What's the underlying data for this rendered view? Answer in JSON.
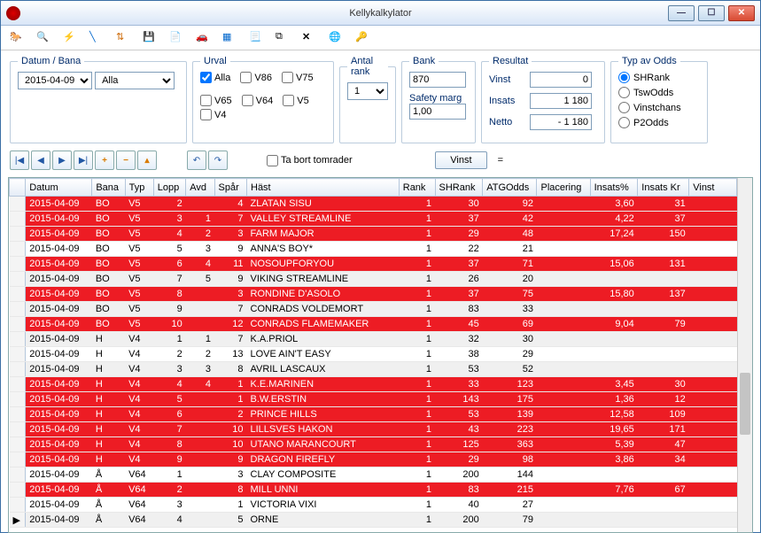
{
  "window": {
    "title": "Kellykalkylator"
  },
  "fieldsets": {
    "datum_bana": {
      "legend": "Datum / Bana",
      "date": "2015-04-09",
      "bana": "Alla"
    },
    "urval": {
      "legend": "Urval",
      "alla": "Alla",
      "v86": "V86",
      "v75": "V75",
      "v65": "V65",
      "v64": "V64",
      "v5": "V5",
      "v4": "V4"
    },
    "antal_rank": {
      "legend": "Antal rank",
      "value": "1"
    },
    "bank": {
      "legend": "Bank",
      "value": "870",
      "safety_label": "Safety marg",
      "safety_value": "1,00"
    },
    "resultat": {
      "legend": "Resultat",
      "vinst_label": "Vinst",
      "vinst": "0",
      "insats_label": "Insats",
      "insats": "1 180",
      "netto_label": "Netto",
      "netto": "- 1 180"
    },
    "typ": {
      "legend": "Typ av Odds",
      "shrank": "SHRank",
      "tswodds": "TswOdds",
      "vinstchans": "Vinstchans",
      "p2odds": "P2Odds"
    }
  },
  "tabort": "Ta bort tomrader",
  "vinst_btn": "Vinst",
  "eq": "=",
  "columns": [
    "",
    "Datum",
    "Bana",
    "Typ",
    "Lopp",
    "Avd",
    "Spår",
    "Häst",
    "Rank",
    "SHRank",
    "ATGOdds",
    "Placering",
    "Insats%",
    "Insats Kr",
    "Vinst"
  ],
  "rows": [
    {
      "red": true,
      "datum": "2015-04-09",
      "bana": "BO",
      "typ": "V5",
      "lopp": "2",
      "avd": "",
      "spar": "4",
      "hast": "ZLATAN SISU",
      "rank": "1",
      "shrank": "30",
      "atg": "92",
      "plac": "",
      "insp": "3,60",
      "inskr": "31",
      "vinst": ""
    },
    {
      "red": true,
      "datum": "2015-04-09",
      "bana": "BO",
      "typ": "V5",
      "lopp": "3",
      "avd": "1",
      "spar": "7",
      "hast": "VALLEY STREAMLINE",
      "rank": "1",
      "shrank": "37",
      "atg": "42",
      "plac": "",
      "insp": "4,22",
      "inskr": "37",
      "vinst": ""
    },
    {
      "red": true,
      "datum": "2015-04-09",
      "bana": "BO",
      "typ": "V5",
      "lopp": "4",
      "avd": "2",
      "spar": "3",
      "hast": "FARM MAJOR",
      "rank": "1",
      "shrank": "29",
      "atg": "48",
      "plac": "",
      "insp": "17,24",
      "inskr": "150",
      "vinst": ""
    },
    {
      "red": false,
      "datum": "2015-04-09",
      "bana": "BO",
      "typ": "V5",
      "lopp": "5",
      "avd": "3",
      "spar": "9",
      "hast": "ANNA'S BOY*",
      "rank": "1",
      "shrank": "22",
      "atg": "21",
      "plac": "",
      "insp": "",
      "inskr": "",
      "vinst": ""
    },
    {
      "red": true,
      "datum": "2015-04-09",
      "bana": "BO",
      "typ": "V5",
      "lopp": "6",
      "avd": "4",
      "spar": "11",
      "hast": "NOSOUPFORYOU",
      "rank": "1",
      "shrank": "37",
      "atg": "71",
      "plac": "",
      "insp": "15,06",
      "inskr": "131",
      "vinst": ""
    },
    {
      "red": false,
      "alt": true,
      "datum": "2015-04-09",
      "bana": "BO",
      "typ": "V5",
      "lopp": "7",
      "avd": "5",
      "spar": "9",
      "hast": "VIKING STREAMLINE",
      "rank": "1",
      "shrank": "26",
      "atg": "20",
      "plac": "",
      "insp": "",
      "inskr": "",
      "vinst": ""
    },
    {
      "red": true,
      "datum": "2015-04-09",
      "bana": "BO",
      "typ": "V5",
      "lopp": "8",
      "avd": "",
      "spar": "3",
      "hast": "RONDINE D'ASOLO",
      "rank": "1",
      "shrank": "37",
      "atg": "75",
      "plac": "",
      "insp": "15,80",
      "inskr": "137",
      "vinst": ""
    },
    {
      "red": false,
      "alt": true,
      "datum": "2015-04-09",
      "bana": "BO",
      "typ": "V5",
      "lopp": "9",
      "avd": "",
      "spar": "7",
      "hast": "CONRADS VOLDEMORT",
      "rank": "1",
      "shrank": "83",
      "atg": "33",
      "plac": "",
      "insp": "",
      "inskr": "",
      "vinst": ""
    },
    {
      "red": true,
      "datum": "2015-04-09",
      "bana": "BO",
      "typ": "V5",
      "lopp": "10",
      "avd": "",
      "spar": "12",
      "hast": "CONRADS FLAMEMAKER",
      "rank": "1",
      "shrank": "45",
      "atg": "69",
      "plac": "",
      "insp": "9,04",
      "inskr": "79",
      "vinst": ""
    },
    {
      "red": false,
      "alt": true,
      "datum": "2015-04-09",
      "bana": "H",
      "typ": "V4",
      "lopp": "1",
      "avd": "1",
      "spar": "7",
      "hast": "K.A.PRIOL",
      "rank": "1",
      "shrank": "32",
      "atg": "30",
      "plac": "",
      "insp": "",
      "inskr": "",
      "vinst": ""
    },
    {
      "red": false,
      "datum": "2015-04-09",
      "bana": "H",
      "typ": "V4",
      "lopp": "2",
      "avd": "2",
      "spar": "13",
      "hast": "LOVE AIN'T EASY",
      "rank": "1",
      "shrank": "38",
      "atg": "29",
      "plac": "",
      "insp": "",
      "inskr": "",
      "vinst": ""
    },
    {
      "red": false,
      "alt": true,
      "datum": "2015-04-09",
      "bana": "H",
      "typ": "V4",
      "lopp": "3",
      "avd": "3",
      "spar": "8",
      "hast": "AVRIL LASCAUX",
      "rank": "1",
      "shrank": "53",
      "atg": "52",
      "plac": "",
      "insp": "",
      "inskr": "",
      "vinst": ""
    },
    {
      "red": true,
      "datum": "2015-04-09",
      "bana": "H",
      "typ": "V4",
      "lopp": "4",
      "avd": "4",
      "spar": "1",
      "hast": "K.E.MARINEN",
      "rank": "1",
      "shrank": "33",
      "atg": "123",
      "plac": "",
      "insp": "3,45",
      "inskr": "30",
      "vinst": ""
    },
    {
      "red": true,
      "datum": "2015-04-09",
      "bana": "H",
      "typ": "V4",
      "lopp": "5",
      "avd": "",
      "spar": "1",
      "hast": "B.W.ERSTIN",
      "rank": "1",
      "shrank": "143",
      "atg": "175",
      "plac": "",
      "insp": "1,36",
      "inskr": "12",
      "vinst": ""
    },
    {
      "red": true,
      "datum": "2015-04-09",
      "bana": "H",
      "typ": "V4",
      "lopp": "6",
      "avd": "",
      "spar": "2",
      "hast": "PRINCE HILLS",
      "rank": "1",
      "shrank": "53",
      "atg": "139",
      "plac": "",
      "insp": "12,58",
      "inskr": "109",
      "vinst": ""
    },
    {
      "red": true,
      "datum": "2015-04-09",
      "bana": "H",
      "typ": "V4",
      "lopp": "7",
      "avd": "",
      "spar": "10",
      "hast": "LILLSVES HAKON",
      "rank": "1",
      "shrank": "43",
      "atg": "223",
      "plac": "",
      "insp": "19,65",
      "inskr": "171",
      "vinst": ""
    },
    {
      "red": true,
      "datum": "2015-04-09",
      "bana": "H",
      "typ": "V4",
      "lopp": "8",
      "avd": "",
      "spar": "10",
      "hast": "UTANO MARANCOURT",
      "rank": "1",
      "shrank": "125",
      "atg": "363",
      "plac": "",
      "insp": "5,39",
      "inskr": "47",
      "vinst": ""
    },
    {
      "red": true,
      "datum": "2015-04-09",
      "bana": "H",
      "typ": "V4",
      "lopp": "9",
      "avd": "",
      "spar": "9",
      "hast": "DRAGON FIREFLY",
      "rank": "1",
      "shrank": "29",
      "atg": "98",
      "plac": "",
      "insp": "3,86",
      "inskr": "34",
      "vinst": ""
    },
    {
      "red": false,
      "datum": "2015-04-09",
      "bana": "Å",
      "typ": "V64",
      "lopp": "1",
      "avd": "",
      "spar": "3",
      "hast": "CLAY COMPOSITE",
      "rank": "1",
      "shrank": "200",
      "atg": "144",
      "plac": "",
      "insp": "",
      "inskr": "",
      "vinst": ""
    },
    {
      "red": true,
      "datum": "2015-04-09",
      "bana": "Å",
      "typ": "V64",
      "lopp": "2",
      "avd": "",
      "spar": "8",
      "hast": "MILL UNNI",
      "rank": "1",
      "shrank": "83",
      "atg": "215",
      "plac": "",
      "insp": "7,76",
      "inskr": "67",
      "vinst": ""
    },
    {
      "red": false,
      "datum": "2015-04-09",
      "bana": "Å",
      "typ": "V64",
      "lopp": "3",
      "avd": "",
      "spar": "1",
      "hast": "VICTORIA VIXI",
      "rank": "1",
      "shrank": "40",
      "atg": "27",
      "plac": "",
      "insp": "",
      "inskr": "",
      "vinst": ""
    },
    {
      "red": false,
      "alt": true,
      "cursor": true,
      "datum": "2015-04-09",
      "bana": "Å",
      "typ": "V64",
      "lopp": "4",
      "avd": "",
      "spar": "5",
      "hast": "ORNE",
      "rank": "1",
      "shrank": "200",
      "atg": "79",
      "plac": "",
      "insp": "",
      "inskr": "",
      "vinst": ""
    }
  ]
}
